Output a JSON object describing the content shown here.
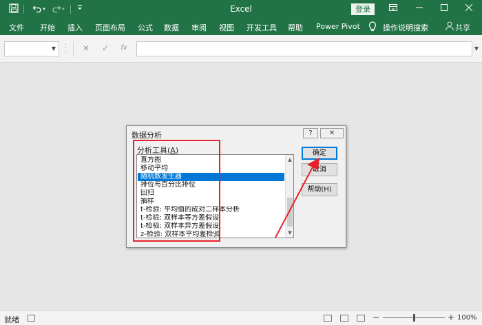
{
  "window": {
    "title": "Excel",
    "login_label": "登录",
    "restore_icon": "ribbon-display-icon",
    "minimize_icon": "minimize-icon",
    "maximize_icon": "maximize-icon",
    "close_icon": "close-icon"
  },
  "quick_access": {
    "save_icon": "save-icon",
    "undo_icon": "undo-icon",
    "redo_icon": "redo-icon",
    "customize_icon": "customize-qat-icon"
  },
  "ribbon": {
    "tabs": [
      "文件",
      "开始",
      "插入",
      "页面布局",
      "公式",
      "数据",
      "审阅",
      "视图",
      "开发工具",
      "帮助",
      "Power Pivot"
    ],
    "search_label": "操作说明搜索",
    "share_label": "共享"
  },
  "formula_bar": {
    "name_box_value": "",
    "formula_value": "",
    "cancel_glyph": "✕",
    "enter_glyph": "✓",
    "fx_glyph": "fx"
  },
  "dialog": {
    "title": "数据分析",
    "help_glyph": "?",
    "close_glyph": "✕",
    "list_label_prefix": "分析工具(",
    "list_label_key": "A",
    "list_label_suffix": ")",
    "items": [
      "直方图",
      "移动平均",
      "随机数发生器",
      "排位与百分比排位",
      "回归",
      "抽样",
      "t-检验: 平均值的成对二样本分析",
      "t-检验: 双样本等方差假设",
      "t-检验: 双样本异方差假设",
      "z-检验: 双样本平均差检验"
    ],
    "selected_index": 2,
    "ok_label": "确定",
    "cancel_label": "取消",
    "help_label": "帮助(H)"
  },
  "annotation": {
    "highlight_color": "#e8202a"
  },
  "statusbar": {
    "ready": "就绪",
    "zoom": "100%"
  },
  "colors": {
    "excel_green": "#217346",
    "selection_blue": "#0078d7"
  }
}
